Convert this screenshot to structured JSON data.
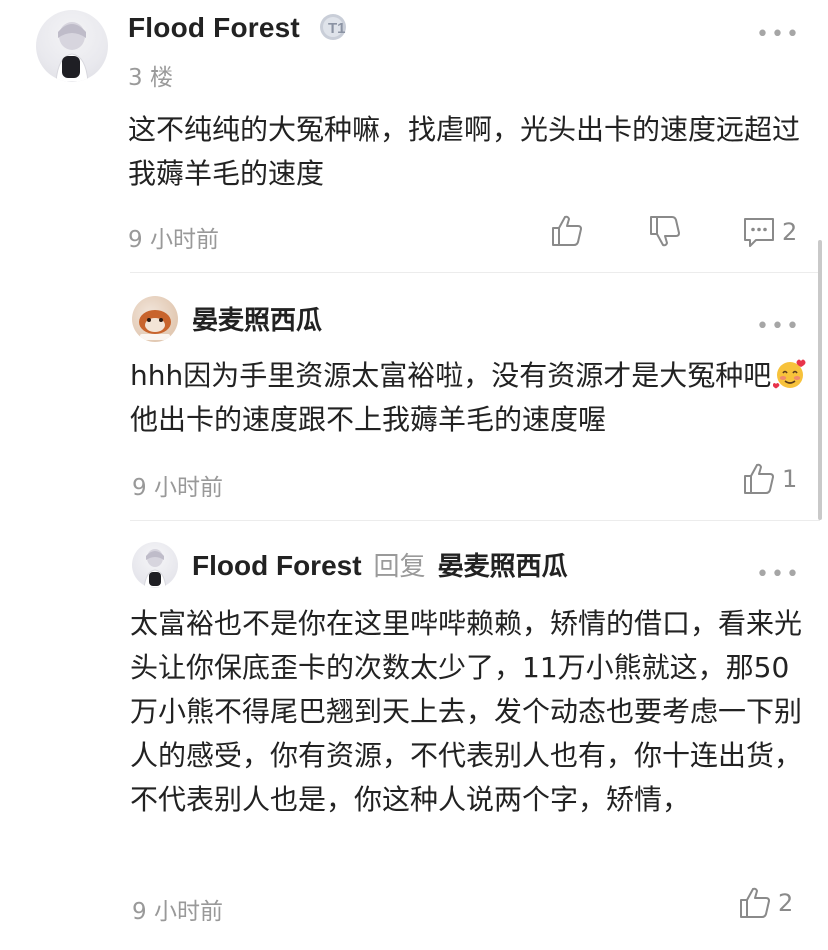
{
  "main_comment": {
    "author": "Flood Forest",
    "badge_label": "T1",
    "floor": "3 楼",
    "text": "这不纯纯的大冤种嘛，找虐啊，光头出卡的速度远超过我薅羊毛的速度",
    "time": "9 小时前",
    "comment_count": "2"
  },
  "replies": [
    {
      "author": "晏麦照西瓜",
      "text_before_emoji": "hhh因为手里资源太富裕啦，没有资源才是大冤种吧",
      "text_after_emoji": "他出卡的速度跟不上我薅羊毛的速度喔",
      "time": "9 小时前",
      "like_count": "1"
    },
    {
      "author": "Flood Forest",
      "reply_label": "回复",
      "reply_to": "晏麦照西瓜",
      "text": "太富裕也不是你在这里哔哔赖赖，矫情的借口，看来光头让你保底歪卡的次数太少了，11万小熊就这，那50万小熊不得尾巴翘到天上去，发个动态也要考虑一下别人的感受，你有资源，不代表别人也有，你十连出货，不代表别人也是，你这种人说两个字，矫情，",
      "time": "9 小时前",
      "like_count": "2"
    }
  ],
  "colors": {
    "text": "#222222",
    "muted": "#999999",
    "icon": "#8a8a8a",
    "divider": "#ececec"
  }
}
